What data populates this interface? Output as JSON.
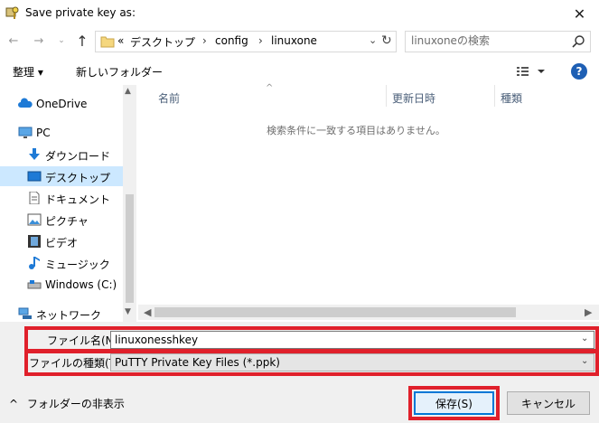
{
  "window": {
    "title": "Save private key as:",
    "close_glyph": "✕"
  },
  "nav": {
    "back_glyph": "←",
    "forward_glyph": "→",
    "recent_glyph": "⌄",
    "up_glyph": "↑"
  },
  "address": {
    "overflow": "«",
    "crumbs": [
      "デスクトップ",
      "config",
      "linuxone"
    ],
    "separator": "›",
    "dropdown_glyph": "⌄",
    "refresh_glyph": "↻"
  },
  "search": {
    "placeholder": "linuxoneの検索"
  },
  "toolbar": {
    "organize": "整理 ▾",
    "new_folder": "新しいフォルダー",
    "help": "?"
  },
  "sidebar": {
    "items": [
      {
        "label": "OneDrive",
        "icon": "cloud-icon"
      },
      {
        "label": "PC",
        "icon": "computer-icon"
      },
      {
        "label": "ダウンロード",
        "icon": "download-icon"
      },
      {
        "label": "デスクトップ",
        "icon": "desktop-icon"
      },
      {
        "label": "ドキュメント",
        "icon": "document-icon"
      },
      {
        "label": "ピクチャ",
        "icon": "pictures-icon"
      },
      {
        "label": "ビデオ",
        "icon": "video-icon"
      },
      {
        "label": "ミュージック",
        "icon": "music-icon"
      },
      {
        "label": "Windows (C:)",
        "icon": "drive-icon"
      },
      {
        "label": "ネットワーク",
        "icon": "network-icon"
      }
    ],
    "selected": "デスクトップ"
  },
  "filelist": {
    "columns": [
      "名前",
      "更新日時",
      "種類"
    ],
    "empty_message": "検索条件に一致する項目はありません。"
  },
  "form": {
    "filename_label": "ファイル名(N):",
    "filename_value": "linuxonesshkey",
    "filetype_label": "ファイルの種類(T):",
    "filetype_value": "PuTTY Private Key Files (*.ppk)",
    "dropdown_glyph": "⌄"
  },
  "footer": {
    "hide_folders": "フォルダーの非表示",
    "hide_glyph": "^",
    "save": "保存(S)",
    "cancel": "キャンセル"
  },
  "colors": {
    "highlight_red": "#e0202b",
    "selected_bg": "#cce8ff",
    "help_blue": "#1e5fb4",
    "focus_blue": "#0078d7"
  }
}
